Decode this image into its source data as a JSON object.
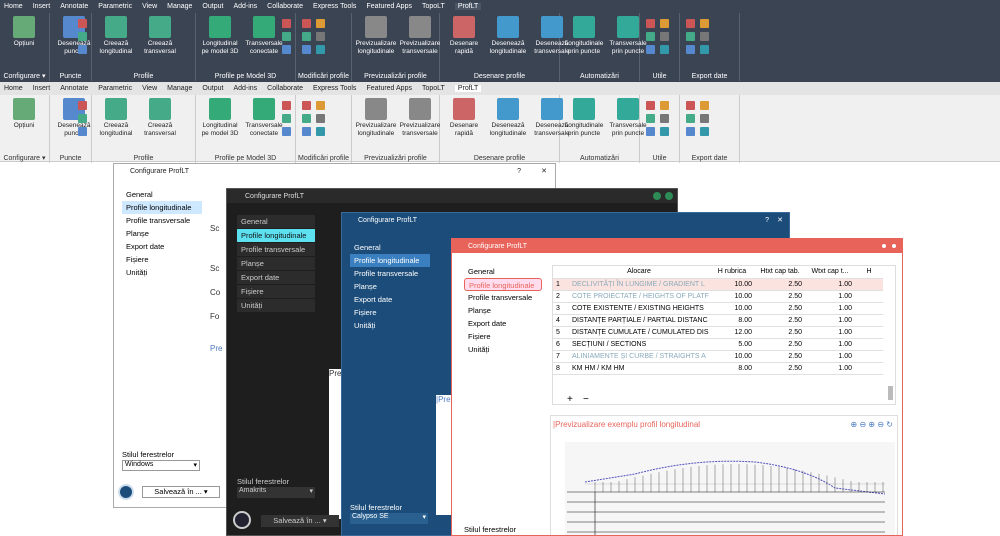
{
  "ribbon": {
    "tabs": [
      "Home",
      "Insert",
      "Annotate",
      "Parametric",
      "View",
      "Manage",
      "Output",
      "Add-ins",
      "Collaborate",
      "Express Tools",
      "Featured Apps",
      "TopoLT",
      "ProfLT"
    ],
    "active_tab": "ProfLT",
    "panels": [
      "Configurare",
      "Puncte",
      "Profile",
      "Profile pe Model 3D",
      "Modificări profile",
      "Previzualizări profile",
      "Desenare profile",
      "Automatizări",
      "Utile",
      "Export date"
    ],
    "buttons": {
      "optiuni": "Opțiuni",
      "deseneaza_puncte": "Desenează puncte",
      "creeaza_long": "Creează longitudinal",
      "creeaza_trans": "Creează transversal",
      "long_model": "Longitudinal pe model 3D",
      "trans_conectate": "Transversale conectate",
      "prev_long": "Previzualizare longitudinale",
      "prev_trans": "Previzualizare transversale",
      "desenare_rapida": "Desenare rapidă",
      "des_long": "Desenează longitudinale",
      "des_trans": "Desenează transversale",
      "long_puncte": "Longitudinale prin puncte",
      "trans_puncte": "Transversale prin puncte"
    }
  },
  "dialog": {
    "title": "Configurare ProfLT",
    "nav": [
      "General",
      "Profile longitudinale",
      "Profile transversale",
      "Planșe",
      "Export date",
      "Fișiere",
      "Unități"
    ],
    "style_label": "Stilul ferestrelor",
    "save_label": "Salvează în ...",
    "themes": [
      "Windows",
      "Amakrits",
      "Calypso SE"
    ],
    "partial_texts": [
      "Sc",
      "Sc",
      "Co",
      "Fo",
      "Pre",
      "Pre",
      "|Pre"
    ]
  },
  "table": {
    "headers": [
      "Alocare",
      "H rubrica",
      "Htxt cap tab.",
      "Wtxt cap t...",
      "H"
    ],
    "rows": [
      {
        "n": "1",
        "name": "DECLIVITĂȚI ÎN LUNGIME / GRADIENT L",
        "h": "10.00",
        "ht": "2.50",
        "wt": "1.00"
      },
      {
        "n": "2",
        "name": "COTE PROIECTATE / HEIGHTS OF PLATF",
        "h": "10.00",
        "ht": "2.50",
        "wt": "1.00"
      },
      {
        "n": "3",
        "name": "COTE EXISTENTE / EXISTING HEIGHTS",
        "h": "10.00",
        "ht": "2.50",
        "wt": "1.00"
      },
      {
        "n": "4",
        "name": "DISTANȚE PARȚIALE / PARTIAL DISTANC",
        "h": "8.00",
        "ht": "2.50",
        "wt": "1.00"
      },
      {
        "n": "5",
        "name": "DISTANȚE CUMULATE / CUMULATED DIS",
        "h": "12.00",
        "ht": "2.50",
        "wt": "1.00"
      },
      {
        "n": "6",
        "name": "SECȚIUNI / SECTIONS",
        "h": "5.00",
        "ht": "2.50",
        "wt": "1.00"
      },
      {
        "n": "7",
        "name": "ALINIAMENTE ȘI CURBE / STRAIGHTS A",
        "h": "10.00",
        "ht": "2.50",
        "wt": "1.00"
      },
      {
        "n": "8",
        "name": "KM HM / KM HM",
        "h": "8.00",
        "ht": "2.50",
        "wt": "1.00"
      }
    ],
    "add": "+",
    "remove": "−",
    "preview_title": "|Previzualizare exemplu profil longitudinal"
  },
  "colors": {
    "accent_red": "#e8645a",
    "cyan": "#5de0f0",
    "blue": "#1c4d7a"
  }
}
